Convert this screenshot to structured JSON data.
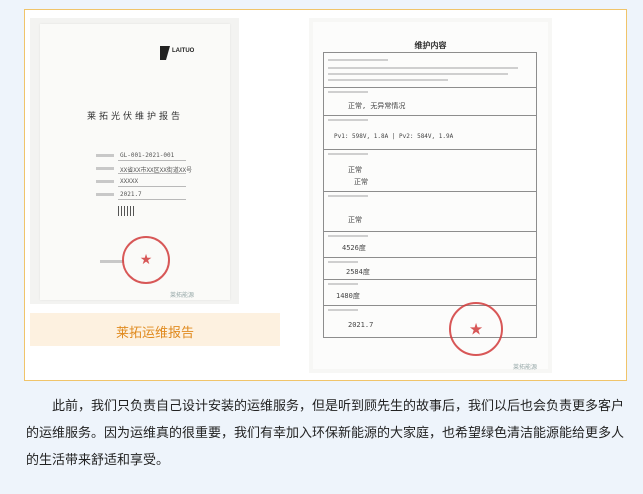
{
  "report_photo": {
    "logo_text": "LAITUO",
    "title": "莱拓光伏维护报告",
    "fields": [
      "GL-001-2021-001",
      "XX省XX市XX区XX街道XX号",
      "XXXXX",
      "2021.7"
    ],
    "watermark": "莱拓能源"
  },
  "caption": "莱拓运维报告",
  "maintenance_photo": {
    "title": "维护内容",
    "hand_notes": [
      "正常, 无异常情况",
      "Pv1: 598V, 1.8A | Pv2: 584V, 1.9A",
      "正常",
      "正常",
      "正常",
      "4526度",
      "2584度",
      "1480度",
      "2021.7"
    ],
    "watermark": "莱拓能源"
  },
  "body_text": "此前，我们只负责自己设计安装的运维服务，但是听到顾先生的故事后，我们以后也会负责更多客户的运维服务。因为运维真的很重要，我们有幸加入环保新能源的大家庭，也希望绿色清洁能源能给更多人的生活带来舒适和享受。",
  "colors": {
    "frame_border": "#f0c46a",
    "caption_bg": "#fdf1e0",
    "caption_text": "#e08a1e",
    "seal_red": "#d23b3b",
    "page_bg": "#eef4fb"
  }
}
